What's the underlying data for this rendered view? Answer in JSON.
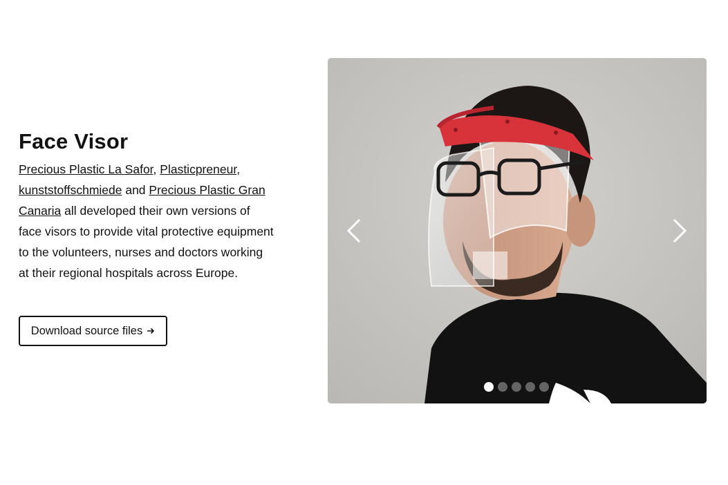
{
  "section": {
    "title": "Face Visor",
    "description": {
      "link1": "Precious Plastic La Safor",
      "sep1": ", ",
      "link2": "Plasticpreneur",
      "sep2": ",",
      "link3": "kunststoffschmiede",
      "sep3": " and ",
      "link4": "Precious Plastic Gran Canaria",
      "rest": " all developed their own versions of face visors to provide vital protective equipment to the volunteers, nurses and doctors working at their regional hospitals across Europe."
    },
    "button_label": "Download source files",
    "button_icon": "arrow-right-icon"
  },
  "carousel": {
    "image_alt": "Man wearing a transparent face visor with a red headband",
    "prev_icon": "chevron-left-icon",
    "next_icon": "chevron-right-icon",
    "slide_count": 5,
    "active_slide": 1
  },
  "colors": {
    "visor_band": "#d8323a",
    "wall": "#c9c7c3",
    "shirt": "#121212"
  }
}
